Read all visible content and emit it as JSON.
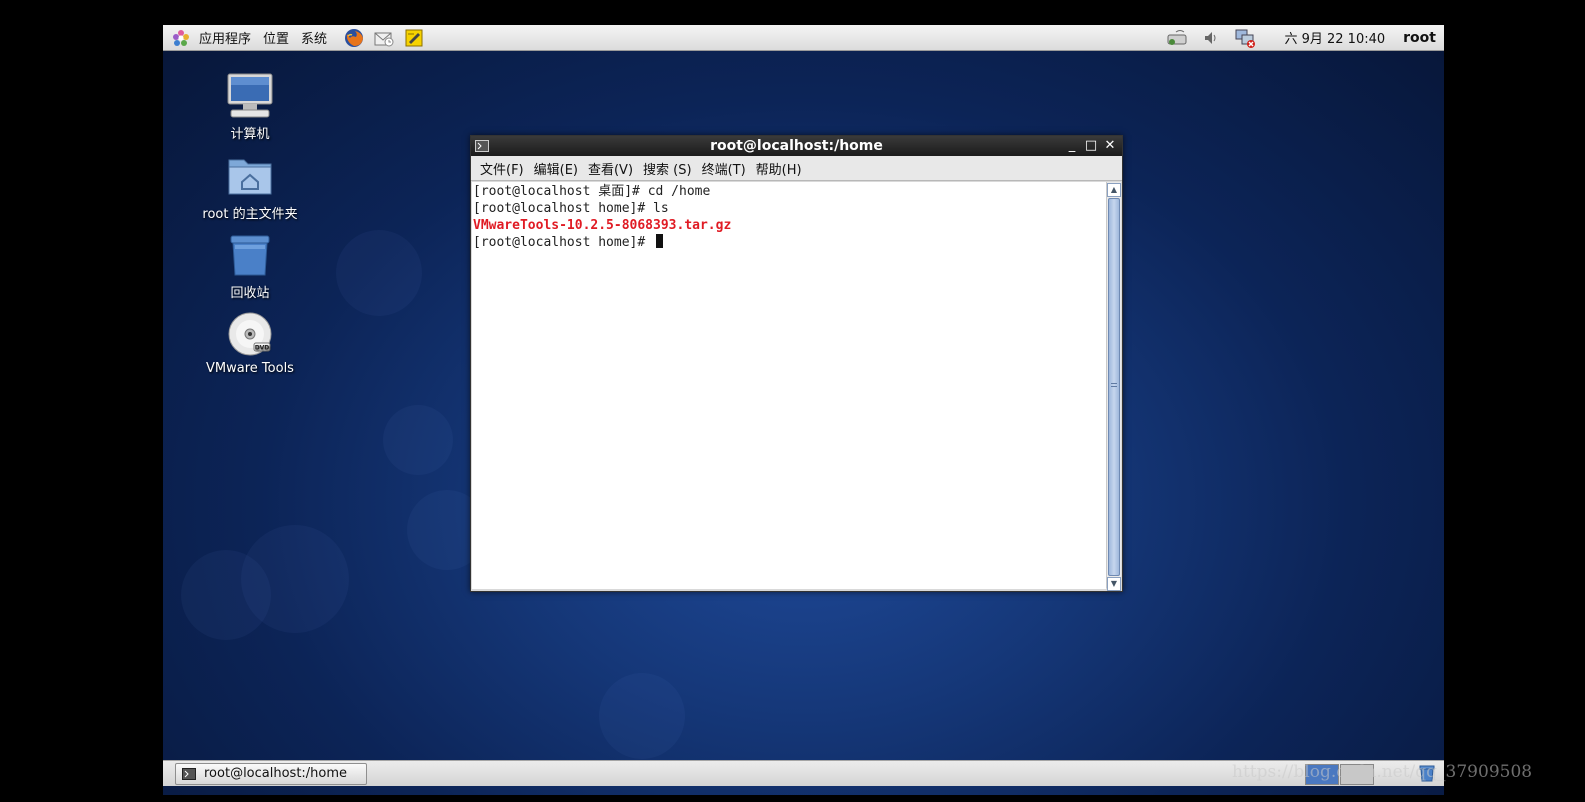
{
  "top_panel": {
    "menus": [
      "应用程序",
      "位置",
      "系统"
    ],
    "clock": "六 9月 22 10:40",
    "user": "root"
  },
  "desktop_icons": [
    {
      "label": "计算机",
      "icon": "computer-icon"
    },
    {
      "label": "root 的主文件夹",
      "icon": "home-folder-icon"
    },
    {
      "label": "回收站",
      "icon": "trash-icon"
    },
    {
      "label": "VMware Tools",
      "icon": "dvd-icon"
    }
  ],
  "terminal": {
    "title": "root@localhost:/home",
    "menus": [
      "文件(F)",
      "编辑(E)",
      "查看(V)",
      "搜索 (S)",
      "终端(T)",
      "帮助(H)"
    ],
    "lines": [
      "[root@localhost 桌面]# cd /home",
      "[root@localhost home]# ls",
      "VMwareTools-10.2.5-8068393.tar.gz",
      "[root@localhost home]# "
    ]
  },
  "taskbar": {
    "task_label": "root@localhost:/home"
  },
  "watermark": "https://blog.csdn.net/qq_37909508",
  "colors": {
    "highlight_file": "#e01b24",
    "desktop_bg": "#153778"
  }
}
